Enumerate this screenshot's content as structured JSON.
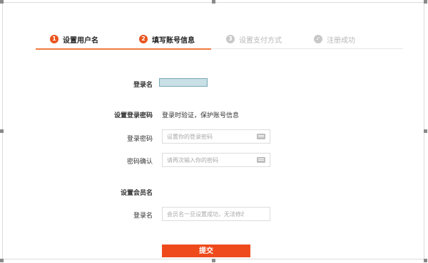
{
  "steps": [
    {
      "num": "1",
      "label": "设置用户名",
      "state": "active"
    },
    {
      "num": "2",
      "label": "填写账号信息",
      "state": "active"
    },
    {
      "num": "3",
      "label": "设置支付方式",
      "state": "inactive"
    },
    {
      "num": "✓",
      "label": "注册成功",
      "state": "inactive"
    }
  ],
  "form": {
    "username_label": "登录名",
    "password_section_label": "设置登录密码",
    "password_section_hint": "登录时验证，保护账号信息",
    "password_label": "登录密码",
    "password_placeholder": "设置你的登录密码",
    "confirm_label": "密码确认",
    "confirm_placeholder": "请再次输入你的密码",
    "member_section_label": "设置会员名",
    "member_label": "登录名",
    "member_placeholder": "会员名一旦设置成功，无法修改",
    "submit_label": "提交"
  },
  "colors": {
    "accent": "#ef4a1b",
    "active_underline": "#f07b3f",
    "inactive": "#c8c8c8"
  }
}
